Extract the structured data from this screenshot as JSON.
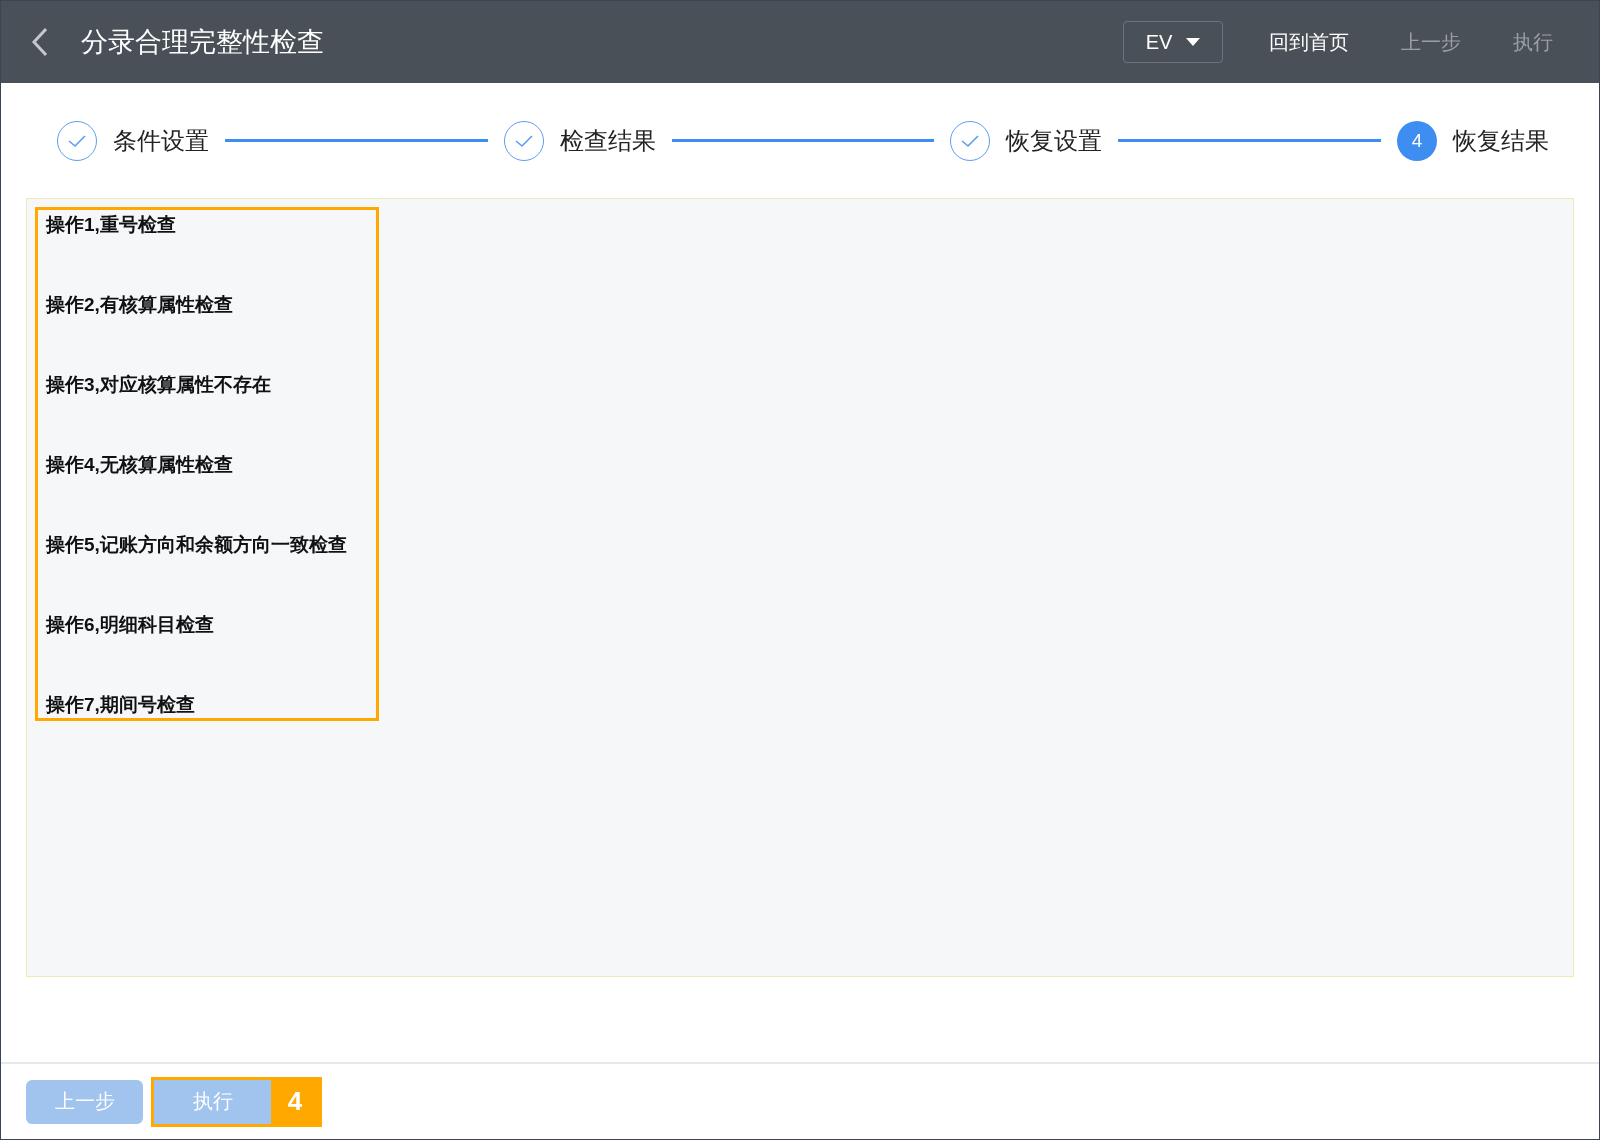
{
  "header": {
    "title": "分录合理完整性检查",
    "dropdown": "EV",
    "actions": [
      {
        "label": "回到首页",
        "disabled": false
      },
      {
        "label": "上一步",
        "disabled": true
      },
      {
        "label": "执行",
        "disabled": true
      }
    ]
  },
  "steps": [
    {
      "label": "条件设置",
      "completed": true
    },
    {
      "label": "检查结果",
      "completed": true
    },
    {
      "label": "恢复设置",
      "completed": true
    },
    {
      "label": "恢复结果",
      "completed": false,
      "number": "4"
    }
  ],
  "results": {
    "highlighted": true,
    "items": [
      "操作1,重号检查",
      "操作2,有核算属性检查",
      "操作3,对应核算属性不存在",
      "操作4,无核算属性检查",
      "操作5,记账方向和余额方向一致检查",
      "操作6,明细科目检查",
      "操作7,期间号检查"
    ]
  },
  "footer": {
    "buttons": [
      {
        "label": "上一步",
        "disabled": true,
        "highlighted": false
      },
      {
        "label": "执行",
        "disabled": true,
        "highlighted": true,
        "callout": "4"
      }
    ]
  }
}
